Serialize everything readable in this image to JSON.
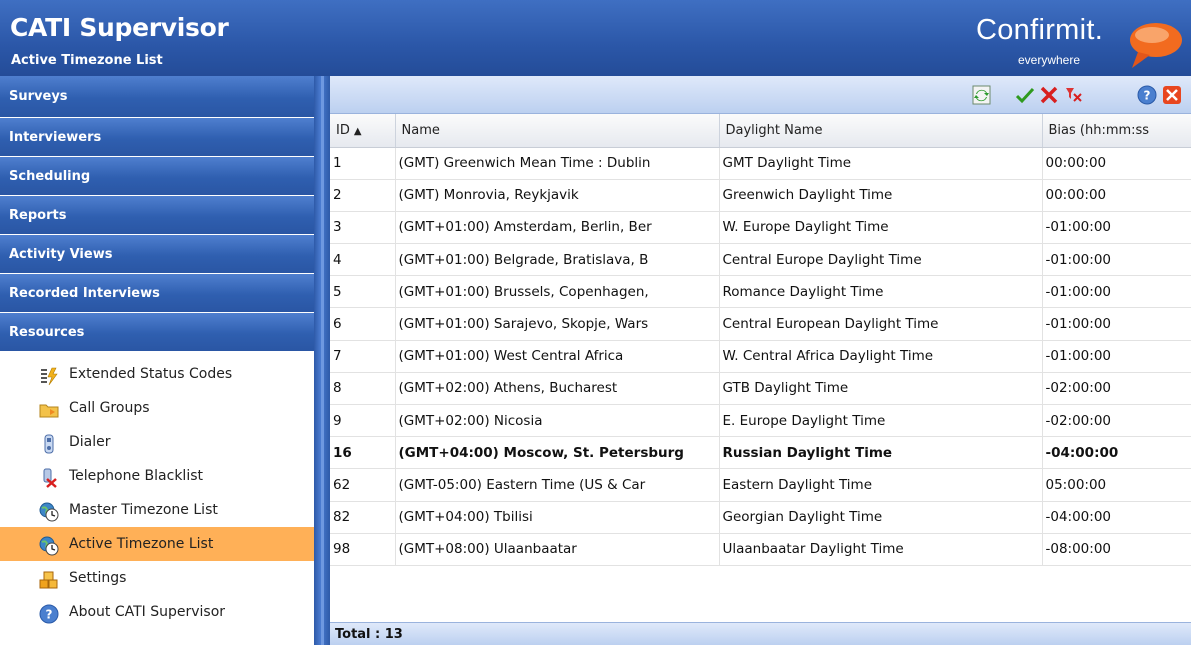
{
  "app": {
    "title": "CATI Supervisor",
    "subtitle": "Active Timezone List",
    "brand": "Confirmit.",
    "brand_tagline": "everywhere"
  },
  "sidebar": {
    "sections": [
      {
        "label": "Surveys"
      },
      {
        "label": "Interviewers"
      },
      {
        "label": "Scheduling"
      },
      {
        "label": "Reports"
      },
      {
        "label": "Activity Views"
      },
      {
        "label": "Recorded Interviews"
      },
      {
        "label": "Resources"
      }
    ],
    "items": [
      {
        "label": "Extended Status Codes",
        "icon": "status-codes-icon"
      },
      {
        "label": "Call Groups",
        "icon": "call-groups-icon"
      },
      {
        "label": "Dialer",
        "icon": "dialer-icon"
      },
      {
        "label": "Telephone Blacklist",
        "icon": "blacklist-icon"
      },
      {
        "label": "Master Timezone List",
        "icon": "timezone-icon"
      },
      {
        "label": "Active Timezone List",
        "icon": "timezone-icon",
        "active": true
      },
      {
        "label": "Settings",
        "icon": "settings-icon"
      },
      {
        "label": "About CATI Supervisor",
        "icon": "help-icon"
      }
    ]
  },
  "toolbar": {
    "buttons": [
      "refresh-icon",
      "check-icon",
      "delete-icon",
      "clear-filter-icon",
      "help-icon",
      "close-icon"
    ]
  },
  "table": {
    "columns": [
      "ID",
      "Name",
      "Daylight Name",
      "Bias (hh:mm:ss"
    ],
    "rows": [
      {
        "id": "1",
        "name": "(GMT) Greenwich Mean Time : Dublin",
        "daylight": "GMT Daylight Time",
        "bias": "00:00:00"
      },
      {
        "id": "2",
        "name": "(GMT) Monrovia, Reykjavik",
        "daylight": "Greenwich Daylight Time",
        "bias": "00:00:00"
      },
      {
        "id": "3",
        "name": "(GMT+01:00) Amsterdam, Berlin, Ber",
        "daylight": "W. Europe Daylight Time",
        "bias": "-01:00:00"
      },
      {
        "id": "4",
        "name": "(GMT+01:00) Belgrade, Bratislava, B",
        "daylight": "Central Europe Daylight Time",
        "bias": "-01:00:00"
      },
      {
        "id": "5",
        "name": "(GMT+01:00) Brussels, Copenhagen,",
        "daylight": "Romance Daylight Time",
        "bias": "-01:00:00"
      },
      {
        "id": "6",
        "name": "(GMT+01:00) Sarajevo, Skopje, Wars",
        "daylight": "Central European Daylight Time",
        "bias": "-01:00:00"
      },
      {
        "id": "7",
        "name": "(GMT+01:00) West Central Africa",
        "daylight": "W. Central Africa Daylight Time",
        "bias": "-01:00:00"
      },
      {
        "id": "8",
        "name": "(GMT+02:00) Athens, Bucharest",
        "daylight": "GTB Daylight Time",
        "bias": "-02:00:00"
      },
      {
        "id": "9",
        "name": "(GMT+02:00) Nicosia",
        "daylight": "E. Europe Daylight Time",
        "bias": "-02:00:00"
      },
      {
        "id": "16",
        "name": "(GMT+04:00) Moscow, St. Petersburg",
        "daylight": "Russian Daylight Time",
        "bias": "-04:00:00",
        "bold": true
      },
      {
        "id": "62",
        "name": "(GMT-05:00) Eastern Time (US & Car",
        "daylight": "Eastern Daylight Time",
        "bias": "05:00:00"
      },
      {
        "id": "82",
        "name": "(GMT+04:00) Tbilisi",
        "daylight": "Georgian Daylight Time",
        "bias": "-04:00:00"
      },
      {
        "id": "98",
        "name": "(GMT+08:00) Ulaanbaatar",
        "daylight": "Ulaanbaatar Daylight Time",
        "bias": "-08:00:00"
      }
    ]
  },
  "footer": {
    "total": "Total : 13"
  }
}
